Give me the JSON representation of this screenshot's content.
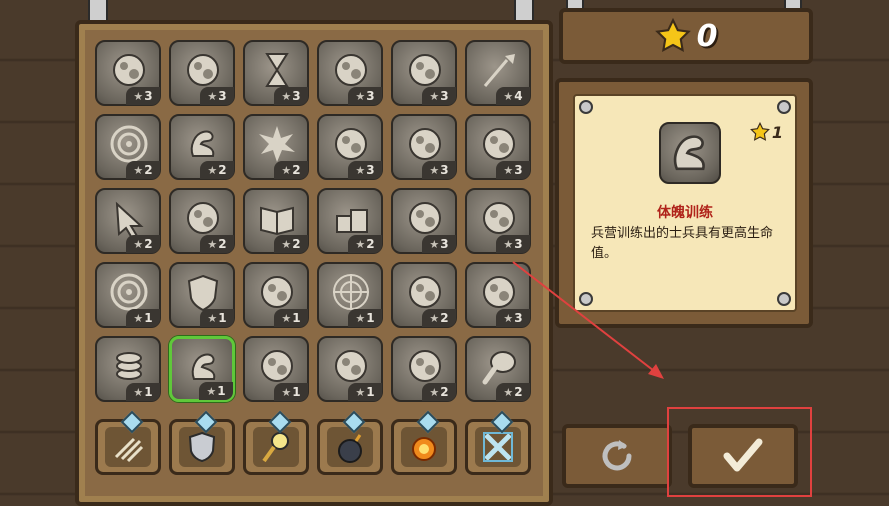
{
  "stars": {
    "count": "0"
  },
  "upgrades": [
    {
      "name": "catapult-icon",
      "cost": "3"
    },
    {
      "name": "helmet-icon",
      "cost": "3"
    },
    {
      "name": "hourglass-icon",
      "cost": "3"
    },
    {
      "name": "signboard-icon",
      "cost": "3"
    },
    {
      "name": "meteors-icon",
      "cost": "3"
    },
    {
      "name": "spear-icon",
      "cost": "4"
    },
    {
      "name": "target-icon",
      "cost": "2"
    },
    {
      "name": "muscle-arm-icon",
      "cost": "2"
    },
    {
      "name": "explosion-icon",
      "cost": "2"
    },
    {
      "name": "factory-icon",
      "cost": "3"
    },
    {
      "name": "spores-icon",
      "cost": "3"
    },
    {
      "name": "viking-helmet-icon",
      "cost": "3"
    },
    {
      "name": "arrow-cursor-icon",
      "cost": "2"
    },
    {
      "name": "dwarf-icon",
      "cost": "2"
    },
    {
      "name": "spellbook-icon",
      "cost": "2"
    },
    {
      "name": "crates-icon",
      "cost": "2"
    },
    {
      "name": "whirlwind-icon",
      "cost": "3"
    },
    {
      "name": "chest-armor-icon",
      "cost": "3"
    },
    {
      "name": "target-icon",
      "cost": "1"
    },
    {
      "name": "shield-icon",
      "cost": "1"
    },
    {
      "name": "rock-burst-icon",
      "cost": "1"
    },
    {
      "name": "radar-icon",
      "cost": "1"
    },
    {
      "name": "tentacles-icon",
      "cost": "2"
    },
    {
      "name": "heavy-armor-icon",
      "cost": "3"
    },
    {
      "name": "coins-icon",
      "cost": "1"
    },
    {
      "name": "muscle-arm-icon",
      "cost": "1",
      "selected": true
    },
    {
      "name": "splash-icon",
      "cost": "1"
    },
    {
      "name": "boulder-icon",
      "cost": "1"
    },
    {
      "name": "fire-meteors-icon",
      "cost": "2"
    },
    {
      "name": "meat-leg-icon",
      "cost": "2"
    }
  ],
  "towers": [
    {
      "name": "archer-tower-icon"
    },
    {
      "name": "barracks-tower-icon"
    },
    {
      "name": "mage-tower-icon"
    },
    {
      "name": "artillery-tower-icon"
    },
    {
      "name": "rain-of-fire-icon"
    },
    {
      "name": "reinforcements-icon"
    }
  ],
  "info": {
    "icon": "muscle-arm-icon",
    "cost": "1",
    "title": "体魄训练",
    "description": "兵营训练出的士兵具有更高生命值。"
  },
  "buttons": {
    "undo_icon": "undo-icon",
    "confirm_icon": "checkmark-icon"
  },
  "colors": {
    "highlight": "#e0413f",
    "selected": "#5fc83a",
    "title": "#b0231a"
  }
}
